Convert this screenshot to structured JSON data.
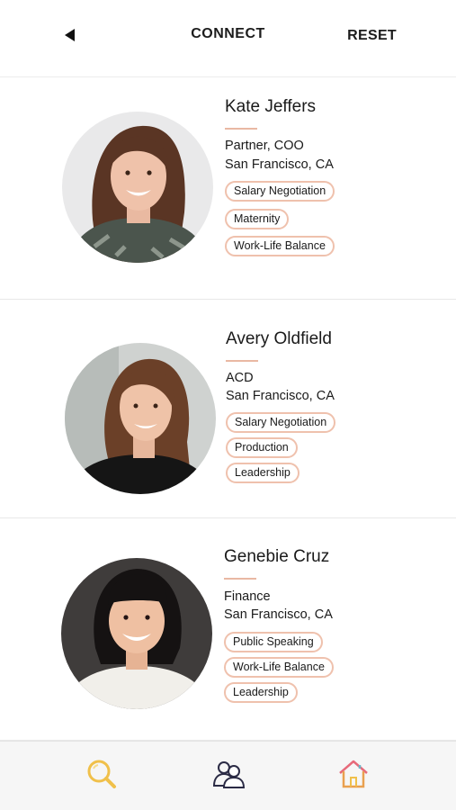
{
  "header": {
    "back_icon": "back-arrow-icon",
    "title": "CONNECT",
    "reset_label": "RESET"
  },
  "profiles": [
    {
      "name": "Kate Jeffers",
      "role": "Partner, COO",
      "location": "San Francisco, CA",
      "tags": [
        "Salary Negotiation",
        "Maternity",
        "Work-Life Balance"
      ]
    },
    {
      "name": "Avery Oldfield",
      "role": "ACD",
      "location": "San Francisco, CA",
      "tags": [
        "Salary Negotiation",
        "Production",
        "Leadership"
      ]
    },
    {
      "name": "Genebie Cruz",
      "role": "Finance",
      "location": "San Francisco, CA",
      "tags": [
        "Public Speaking",
        "Work-Life Balance",
        "Leadership"
      ]
    }
  ],
  "tabbar": {
    "items": [
      {
        "icon": "search-icon"
      },
      {
        "icon": "people-icon"
      },
      {
        "icon": "home-icon"
      }
    ]
  },
  "colors": {
    "tag_border": "#efc1ad",
    "accent_line": "#e9b8a3",
    "search_icon": "#f0c04a",
    "home_icon": "#e76a7a"
  }
}
